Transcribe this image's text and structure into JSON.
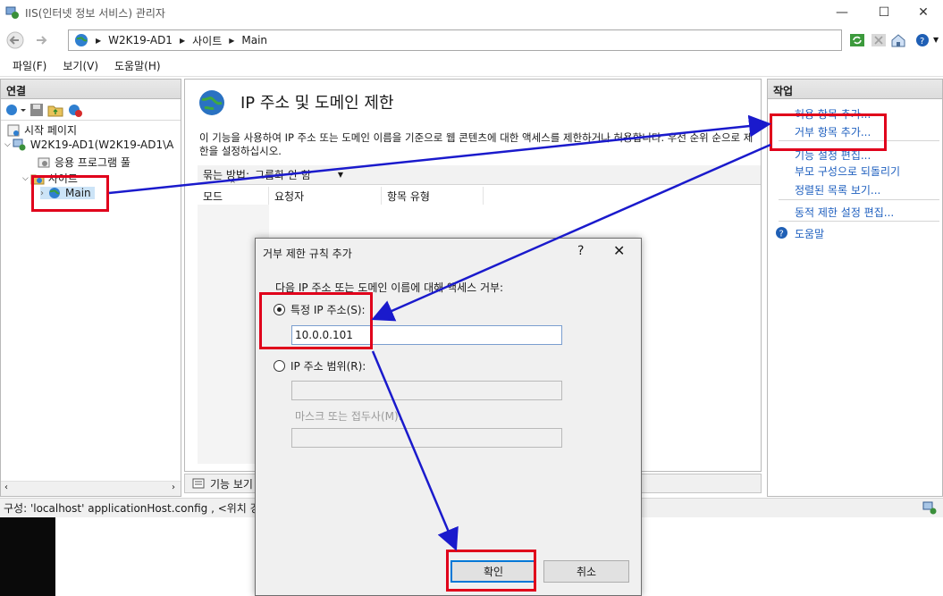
{
  "window": {
    "title": "IIS(인터넷 정보 서비스) 관리자",
    "minimize": "—",
    "maximize": "☐",
    "close": "✕"
  },
  "address": {
    "segments": [
      "W2K19-AD1",
      "사이트",
      "Main"
    ]
  },
  "menu": [
    "파일(F)",
    "보기(V)",
    "도움말(H)"
  ],
  "connections": {
    "header": "연결",
    "tree": [
      {
        "label": "시작 페이지"
      },
      {
        "label": "W2K19-AD1(W2K19-AD1\\A"
      },
      {
        "label": "응용 프로그램 풀"
      },
      {
        "label": "사이트"
      },
      {
        "label": "Main"
      }
    ]
  },
  "feature": {
    "title": "IP 주소 및 도메인 제한",
    "description": "이 기능을 사용하여 IP 주소 또는 도메인 이름을 기준으로 웹 콘텐츠에 대한 액세스를 제한하거나 허용합니다. 우선 순위 순으로 제한을 설정하십시오.",
    "group_by_label": "묶는 방법:",
    "group_by_value": "그룹화 안 함",
    "columns": [
      "모드",
      "요청자",
      "항목 유형"
    ],
    "bottom_tab": "기능 보기"
  },
  "actions": {
    "header": "작업",
    "items": [
      "허용 항목 추가...",
      "거부 항목 추가...",
      "기능 설정 편집...",
      "부모 구성으로 되돌리기",
      "정렬된 목록 보기...",
      "동적 제한 설정 편집...",
      "도움말"
    ]
  },
  "status": {
    "text": "구성: 'localhost' applicationHost.config , <위치 경로"
  },
  "dialog": {
    "title": "거부 제한 규칙 추가",
    "help": "?",
    "close": "✕",
    "prompt": "다음 IP 주소 또는 도메인 이름에 대해 액세스 거부:",
    "specific_ip_label": "특정 IP 주소(S):",
    "specific_ip_value": "10.0.0.101",
    "ip_range_label": "IP 주소 범위(R):",
    "ip_range_value": "",
    "mask_label": "마스크 또는 접두사(M):",
    "mask_value": "",
    "ok": "확인",
    "cancel": "취소"
  },
  "colors": {
    "highlight_box": "#e0001b",
    "annotation_arrow": "#1a1acc",
    "link": "#1e5fbf"
  }
}
